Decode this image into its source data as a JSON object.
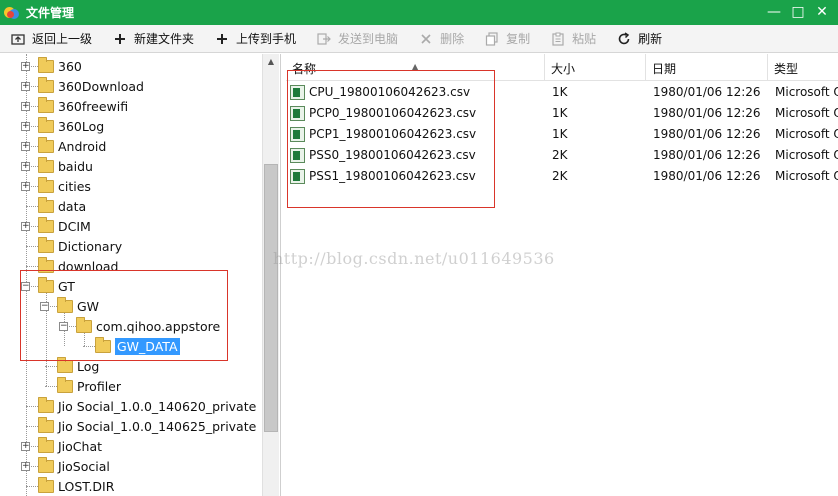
{
  "window": {
    "title": "文件管理",
    "controls": [
      "—",
      "□",
      "✕"
    ]
  },
  "toolbar": {
    "items": [
      {
        "icon": "back-up-icon",
        "label": "返回上一级",
        "enabled": true
      },
      {
        "icon": "plus-icon",
        "label": "新建文件夹",
        "enabled": true
      },
      {
        "icon": "plus-icon",
        "label": "上传到手机",
        "enabled": true
      },
      {
        "icon": "export-icon",
        "label": "发送到电脑",
        "enabled": false
      },
      {
        "icon": "x-icon",
        "label": "删除",
        "enabled": false
      },
      {
        "icon": "copy-icon",
        "label": "复制",
        "enabled": false
      },
      {
        "icon": "paste-icon",
        "label": "粘贴",
        "enabled": false
      },
      {
        "icon": "refresh-icon",
        "label": "刷新",
        "enabled": true
      }
    ]
  },
  "tree": {
    "items": [
      {
        "label": "360",
        "expandable": true
      },
      {
        "label": "360Download",
        "expandable": true
      },
      {
        "label": "360freewifi",
        "expandable": true
      },
      {
        "label": "360Log",
        "expandable": true
      },
      {
        "label": "Android",
        "expandable": true
      },
      {
        "label": "baidu",
        "expandable": true
      },
      {
        "label": "cities",
        "expandable": true
      },
      {
        "label": "data",
        "expandable": false
      },
      {
        "label": "DCIM",
        "expandable": true
      },
      {
        "label": "Dictionary",
        "expandable": false
      },
      {
        "label": "download",
        "expandable": false
      },
      {
        "label": "GT",
        "expandable": true,
        "expanded": true
      },
      {
        "label": "GW",
        "expandable": true,
        "expanded": true
      },
      {
        "label": "com.qihoo.appstore",
        "expandable": true,
        "expanded": true
      },
      {
        "label": "GW_DATA",
        "expandable": false,
        "selected": true
      },
      {
        "label": "Log",
        "expandable": false
      },
      {
        "label": "Profiler",
        "expandable": false
      },
      {
        "label": "Jio Social_1.0.0_140620_private",
        "expandable": false
      },
      {
        "label": "Jio Social_1.0.0_140625_private",
        "expandable": false
      },
      {
        "label": "JioChat",
        "expandable": true
      },
      {
        "label": "JioSocial",
        "expandable": true
      },
      {
        "label": "LOST.DIR",
        "expandable": false
      }
    ]
  },
  "list": {
    "columns": [
      "名称",
      "大小",
      "日期",
      "类型"
    ],
    "rows": [
      {
        "name": "CPU_19800106042623.csv",
        "size": "1K",
        "date": "1980/01/06 12:26",
        "type": "Microsoft O"
      },
      {
        "name": "PCP0_19800106042623.csv",
        "size": "1K",
        "date": "1980/01/06 12:26",
        "type": "Microsoft O"
      },
      {
        "name": "PCP1_19800106042623.csv",
        "size": "1K",
        "date": "1980/01/06 12:26",
        "type": "Microsoft O"
      },
      {
        "name": "PSS0_19800106042623.csv",
        "size": "2K",
        "date": "1980/01/06 12:26",
        "type": "Microsoft O"
      },
      {
        "name": "PSS1_19800106042623.csv",
        "size": "2K",
        "date": "1980/01/06 12:26",
        "type": "Microsoft O"
      }
    ]
  },
  "watermark": "http://blog.csdn.net/u011649536",
  "colors": {
    "titlebar": "#1aa34a",
    "selection": "#3399ff",
    "annotation": "#d9352a"
  }
}
